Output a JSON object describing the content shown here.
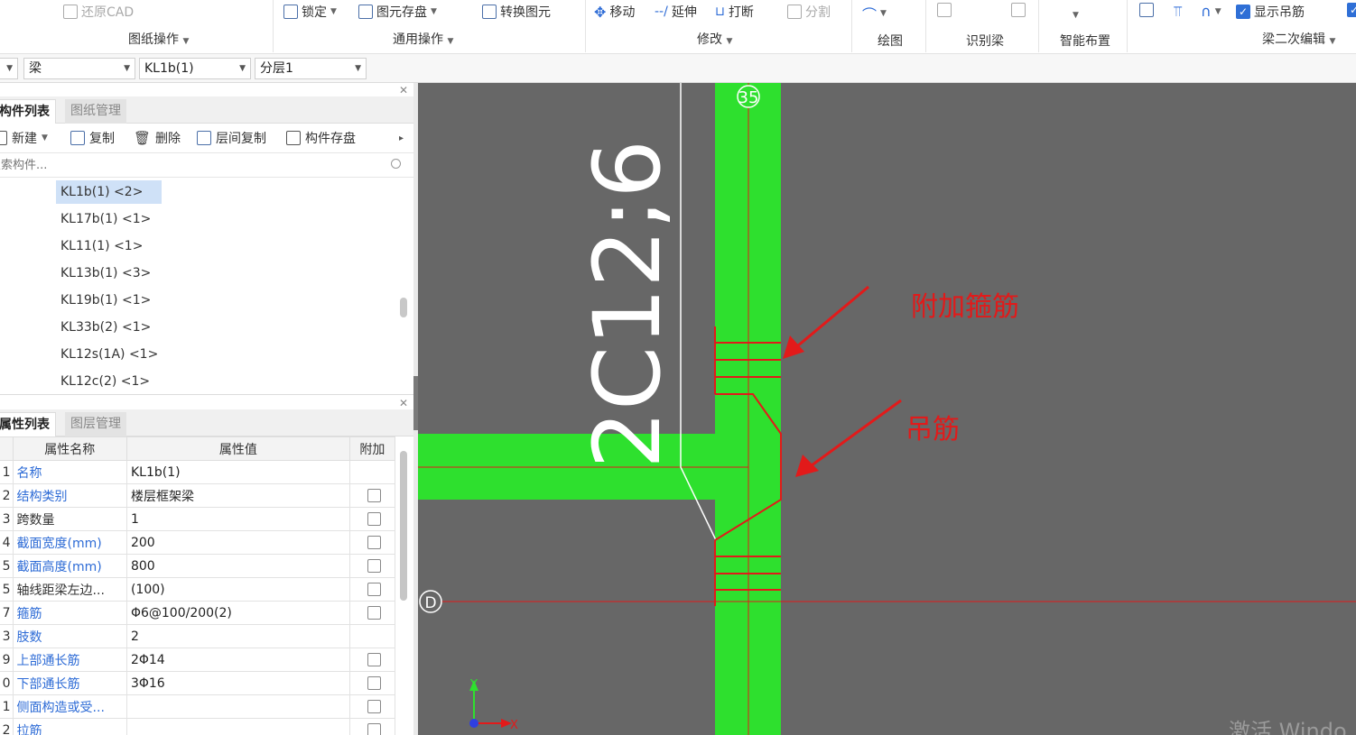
{
  "ribbon": {
    "items": [
      {
        "label": "还原CAD",
        "disabled": true
      },
      {
        "label": "锁定"
      },
      {
        "label": "图元存盘"
      },
      {
        "label": "转换图元"
      },
      {
        "label": "移动"
      },
      {
        "label": "延伸"
      },
      {
        "label": "打断"
      },
      {
        "label": "分割",
        "disabled": true
      },
      {
        "label": "显示吊筋",
        "checked": true
      }
    ],
    "groups": [
      "图纸操作",
      "通用操作",
      "修改",
      "绘图",
      "识别梁",
      "智能布置",
      "梁二次编辑"
    ]
  },
  "combobar": {
    "category": "梁",
    "component": "KL1b(1)",
    "layer": "分层1"
  },
  "component_panel": {
    "tabs": [
      "构件列表",
      "图纸管理"
    ],
    "toolbar": [
      "新建",
      "复制",
      "删除",
      "层间复制",
      "构件存盘"
    ],
    "search_placeholder": "搜索构件...",
    "items": [
      "KL1b(1) <2>",
      "KL17b(1) <1>",
      "KL11(1) <1>",
      "KL13b(1) <3>",
      "KL19b(1) <1>",
      "KL33b(2) <1>",
      "KL12s(1A) <1>",
      "KL12c(2) <1>"
    ],
    "selected_index": 0
  },
  "property_panel": {
    "tabs": [
      "属性列表",
      "图层管理"
    ],
    "headers": [
      "属性名称",
      "属性值",
      "附加"
    ],
    "rows": [
      {
        "idx": "1",
        "name": "名称",
        "value": "KL1b(1)",
        "blue": true,
        "check": false
      },
      {
        "idx": "2",
        "name": "结构类别",
        "value": "楼层框架梁",
        "blue": true,
        "check": true
      },
      {
        "idx": "3",
        "name": "跨数量",
        "value": "1",
        "blue": false,
        "check": true
      },
      {
        "idx": "4",
        "name": "截面宽度(mm)",
        "value": "200",
        "blue": true,
        "check": true
      },
      {
        "idx": "5",
        "name": "截面高度(mm)",
        "value": "800",
        "blue": true,
        "check": true
      },
      {
        "idx": "5",
        "name": "轴线距梁左边...",
        "value": "(100)",
        "blue": false,
        "check": true
      },
      {
        "idx": "7",
        "name": "箍筋",
        "value": "Φ6@100/200(2)",
        "blue": true,
        "check": true
      },
      {
        "idx": "3",
        "name": "肢数",
        "value": "2",
        "blue": true,
        "check": false
      },
      {
        "idx": "9",
        "name": "上部通长筋",
        "value": "2Φ14",
        "blue": true,
        "check": true
      },
      {
        "idx": "0",
        "name": "下部通长筋",
        "value": "3Φ16",
        "blue": true,
        "check": true
      },
      {
        "idx": "1",
        "name": "侧面构造或受...",
        "value": "",
        "blue": true,
        "check": true
      },
      {
        "idx": "2",
        "name": "拉筋",
        "value": "",
        "blue": true,
        "check": true
      }
    ]
  },
  "canvas": {
    "rebar_text": "2C12;6",
    "axis_35": "35",
    "axis_d": "D",
    "annotation_stirrup": "附加箍筋",
    "annotation_hanger": "吊筋",
    "ucs_x": "X",
    "ucs_y": "Y",
    "watermark": "激活 Windo",
    "colors": {
      "beam": "#2ee02e",
      "rebar": "#e21a1a",
      "bg": "#676767"
    }
  }
}
